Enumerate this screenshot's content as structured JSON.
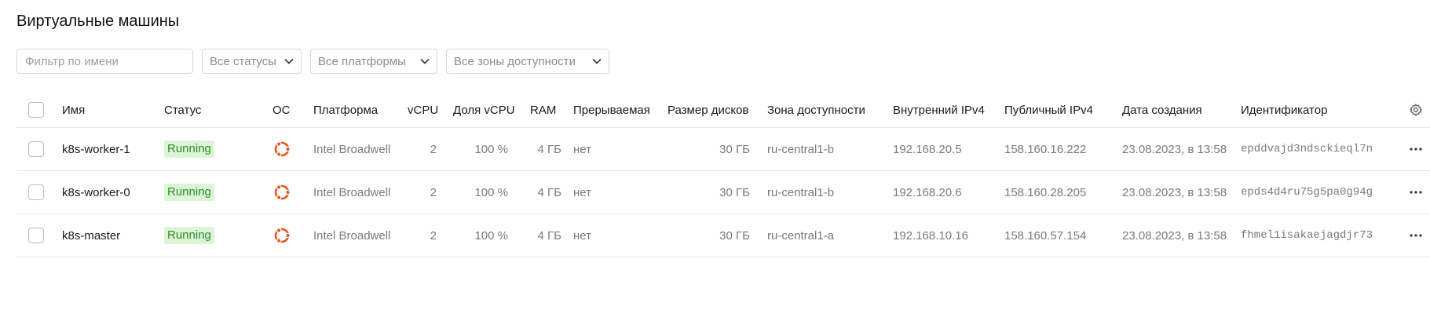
{
  "page": {
    "title": "Виртуальные машины"
  },
  "filters": {
    "name_placeholder": "Фильтр по имени",
    "status": "Все статусы",
    "platform": "Все платформы",
    "zone": "Все зоны доступности"
  },
  "table": {
    "headers": {
      "name": "Имя",
      "status": "Статус",
      "os": "ОС",
      "platform": "Платформа",
      "vcpu": "vCPU",
      "vcpu_share": "Доля vCPU",
      "ram": "RAM",
      "preemptible": "Прерываемая",
      "disk_size": "Размер дисков",
      "zone": "Зона доступности",
      "internal_ip": "Внутренний IPv4",
      "public_ip": "Публичный IPv4",
      "created": "Дата создания",
      "id": "Идентификатор"
    },
    "rows": [
      {
        "name": "k8s-worker-1",
        "status": "Running",
        "os_icon": "ubuntu-icon",
        "platform": "Intel Broadwell",
        "vcpu": "2",
        "vcpu_share": "100 %",
        "ram": "4 ГБ",
        "preemptible": "нет",
        "disk_size": "30 ГБ",
        "zone": "ru-central1-b",
        "internal_ip": "192.168.20.5",
        "public_ip": "158.160.16.222",
        "created": "23.08.2023, в 13:58",
        "id": "epddvajd3ndsckieql7n"
      },
      {
        "name": "k8s-worker-0",
        "status": "Running",
        "os_icon": "ubuntu-icon",
        "platform": "Intel Broadwell",
        "vcpu": "2",
        "vcpu_share": "100 %",
        "ram": "4 ГБ",
        "preemptible": "нет",
        "disk_size": "30 ГБ",
        "zone": "ru-central1-b",
        "internal_ip": "192.168.20.6",
        "public_ip": "158.160.28.205",
        "created": "23.08.2023, в 13:58",
        "id": "epds4d4ru75g5pa0g94g"
      },
      {
        "name": "k8s-master",
        "status": "Running",
        "os_icon": "ubuntu-icon",
        "platform": "Intel Broadwell",
        "vcpu": "2",
        "vcpu_share": "100 %",
        "ram": "4 ГБ",
        "preemptible": "нет",
        "disk_size": "30 ГБ",
        "zone": "ru-central1-a",
        "internal_ip": "192.168.10.16",
        "public_ip": "158.160.57.154",
        "created": "23.08.2023, в 13:58",
        "id": "fhmel1isakaejagdjr73"
      }
    ]
  },
  "colors": {
    "running_bg": "#dcf5d6",
    "running_text": "#2f8a2a",
    "ubuntu": "#e95420"
  }
}
